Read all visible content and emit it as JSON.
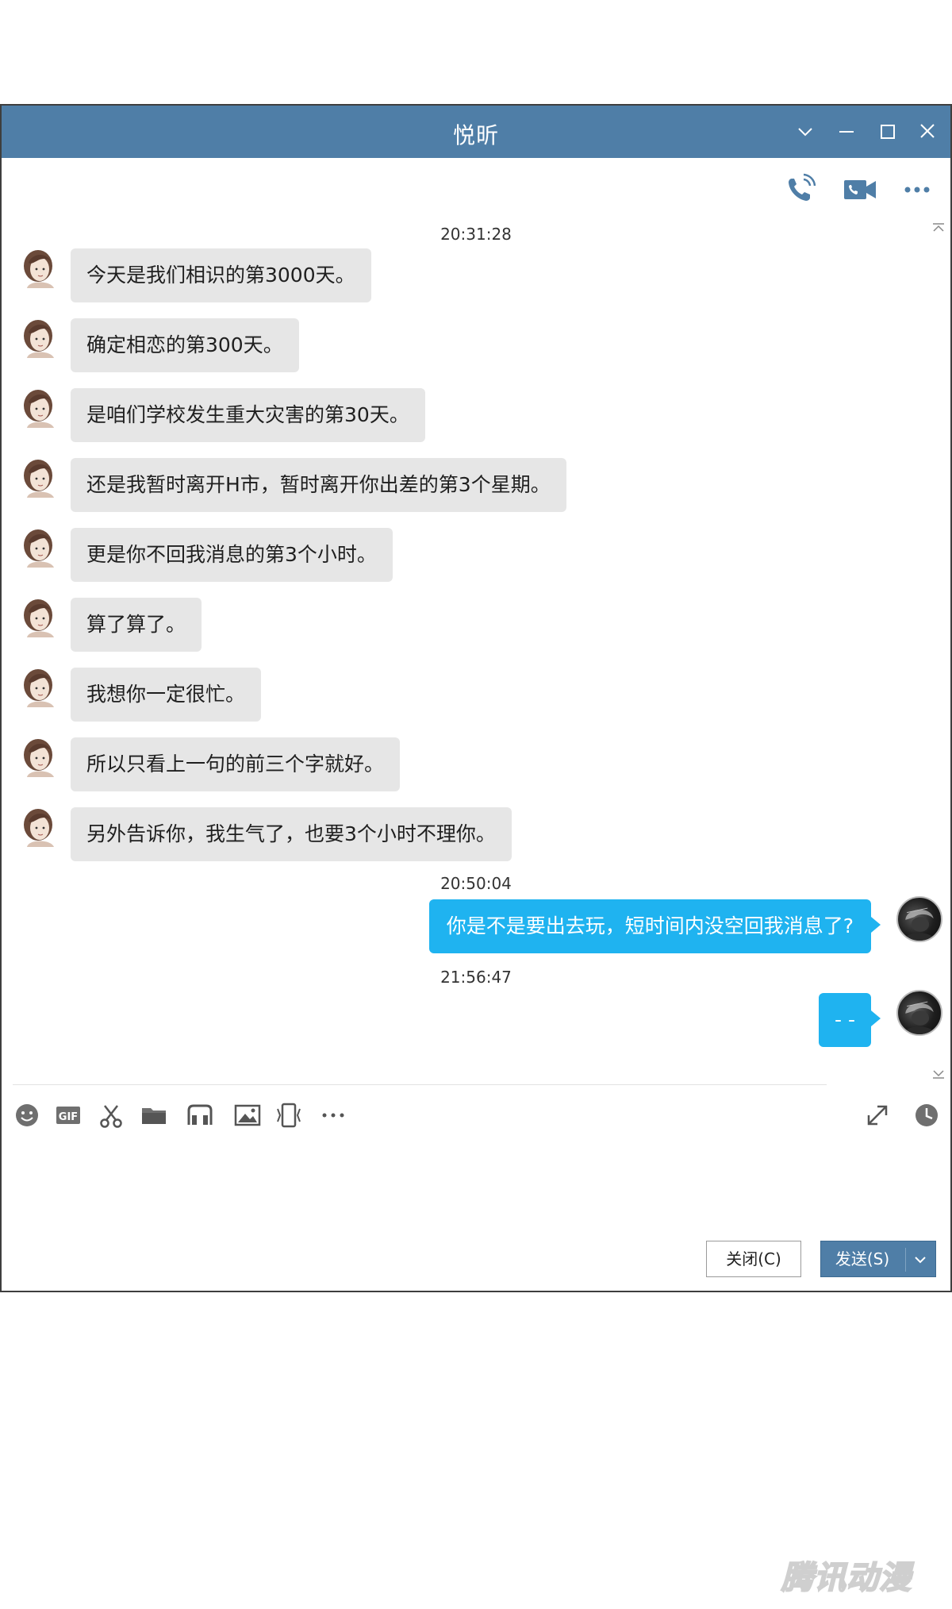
{
  "window": {
    "title": "悦昕",
    "buttons": {
      "dropdown_icon": "chevron-down-icon",
      "minimize_icon": "minimize-icon",
      "maximize_icon": "maximize-icon",
      "close_icon": "close-icon"
    }
  },
  "top_toolbar": {
    "icons": [
      "phone-call-icon",
      "video-call-icon",
      "more-icon"
    ]
  },
  "chat": {
    "timestamps": [
      "20:31:28",
      "20:50:04",
      "21:56:47"
    ],
    "incoming": [
      "今天是我们相识的第3000天。",
      "确定相恋的第300天。",
      "是咱们学校发生重大灾害的第30天。",
      "还是我暂时离开H市，暂时离开你出差的第3个星期。",
      "更是你不回我消息的第3个小时。",
      "算了算了。",
      "我想你一定很忙。",
      "所以只看上一句的前三个字就好。",
      "另外告诉你，我生气了，也要3个小时不理你。"
    ],
    "outgoing": [
      "你是不是要出去玩，短时间内没空回我消息了?",
      "- -"
    ]
  },
  "input_toolbar": {
    "icons": [
      "emoji-icon",
      "gif-icon",
      "screenshot-scissors-icon",
      "folder-icon",
      "music-icon",
      "image-icon",
      "screen-share-icon",
      "more-icon",
      "expand-icon",
      "history-clock-icon"
    ],
    "gif_label": "GIF"
  },
  "buttons": {
    "close_label": "关闭(C)",
    "send_label": "发送(S)"
  },
  "watermark": "腾讯动漫",
  "colors": {
    "titlebar": "#4f7ea7",
    "incoming_bubble": "#e6e6e6",
    "outgoing_bubble": "#1fb3f0"
  }
}
